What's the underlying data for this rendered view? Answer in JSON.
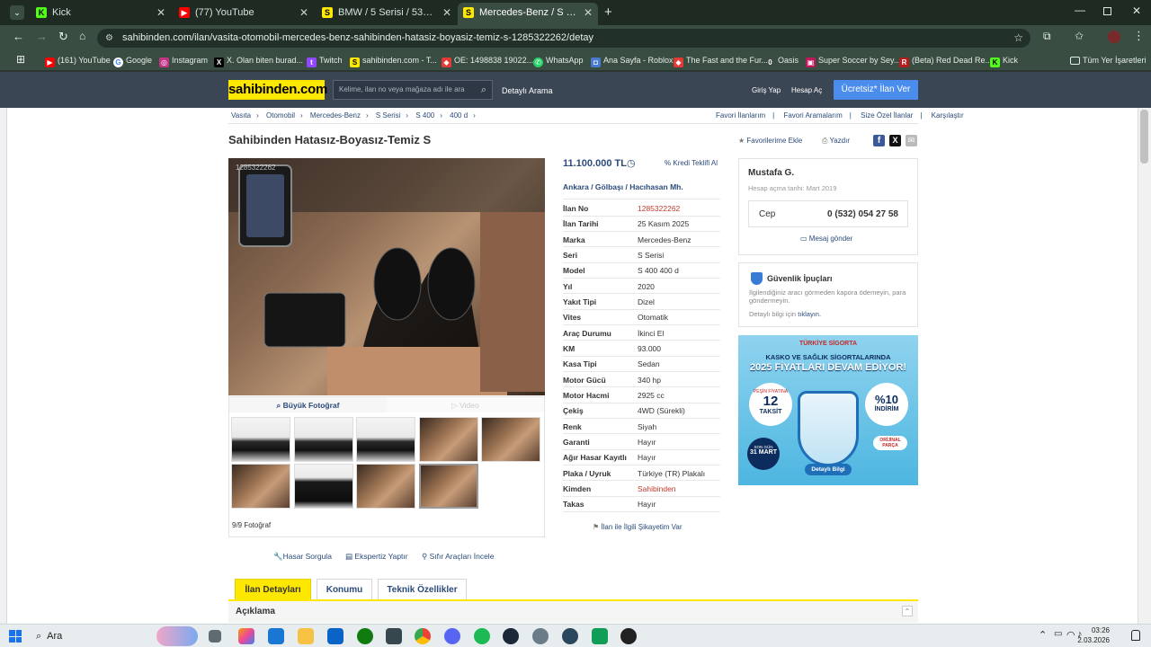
{
  "browser": {
    "tabs": [
      {
        "label": "Kick",
        "active": false
      },
      {
        "label": "(77) YouTube",
        "active": false
      },
      {
        "label": "BMW / 5 Serisi / 530i / Standart",
        "active": false
      },
      {
        "label": "Mercedes-Benz / S Serisi / S 40",
        "active": true
      }
    ],
    "url": "sahibinden.com/ilan/vasita-otomobil-mercedes-benz-sahibinden-hatasiz-boyasiz-temiz-s-1285322262/detay",
    "bookmarks": [
      "(161) YouTube",
      "Google",
      "Instagram",
      "X. Olan biten burad...",
      "Twitch",
      "sahibinden.com - T...",
      "OE: 1498838 19022...",
      "WhatsApp",
      "Ana Sayfa - Roblox",
      "The Fast and the Fur...",
      "Oasis",
      "Super Soccer by Sey...",
      "(Beta) Red Dead Re...",
      "Kick"
    ],
    "all_bookmarks": "Tüm Yer İşaretleri"
  },
  "site": {
    "logo": "sahibinden.com",
    "search_placeholder": "Kelime, ilan no veya mağaza adı ile ara",
    "detailed_search": "Detaylı Arama",
    "login": "Giriş Yap",
    "register": "Hesap Aç",
    "free_ad": "Ücretsiz* İlan Ver"
  },
  "breadcrumbs": [
    "Vasıta",
    "Otomobil",
    "Mercedes-Benz",
    "S Serisi",
    "S 400",
    "400 d"
  ],
  "top_links": [
    "Favori İlanlarım",
    "Favori Aramalarım",
    "Size Özel İlanlar",
    "Karşılaştır"
  ],
  "listing": {
    "title": "Sahibinden Hatasız-Boyasız-Temiz S",
    "add_favorite": "Favorilerime Ekle",
    "print": "Yazdır",
    "watermark": "1285322262",
    "big_photo": "Büyük Fotoğraf",
    "video": "Video",
    "photo_count": "9/9 Fotoğraf",
    "price": "11.100.000 TL",
    "credit": "Kredi Teklifi Al",
    "location": [
      "Ankara",
      "Gölbaşı",
      "Hacıhasan Mh."
    ],
    "specs": [
      {
        "label": "İlan No",
        "value": "1285322262",
        "highlight": true
      },
      {
        "label": "İlan Tarihi",
        "value": "25 Kasım 2025"
      },
      {
        "label": "Marka",
        "value": "Mercedes-Benz"
      },
      {
        "label": "Seri",
        "value": "S Serisi"
      },
      {
        "label": "Model",
        "value": "S 400 400 d"
      },
      {
        "label": "Yıl",
        "value": "2020"
      },
      {
        "label": "Yakıt Tipi",
        "value": "Dizel"
      },
      {
        "label": "Vites",
        "value": "Otomatik"
      },
      {
        "label": "Araç Durumu",
        "value": "İkinci El"
      },
      {
        "label": "KM",
        "value": "93.000"
      },
      {
        "label": "Kasa Tipi",
        "value": "Sedan"
      },
      {
        "label": "Motor Gücü",
        "value": "340 hp"
      },
      {
        "label": "Motor Hacmi",
        "value": "2925 cc"
      },
      {
        "label": "Çekiş",
        "value": "4WD (Sürekli)"
      },
      {
        "label": "Renk",
        "value": "Siyah"
      },
      {
        "label": "Garanti",
        "value": "Hayır"
      },
      {
        "label": "Ağır Hasar Kayıtlı",
        "value": "Hayır"
      },
      {
        "label": "Plaka / Uyruk",
        "value": "Türkiye (TR) Plakalı"
      },
      {
        "label": "Kimden",
        "value": "Sahibinden",
        "highlight": true
      },
      {
        "label": "Takas",
        "value": "Hayır"
      }
    ],
    "complaint": "İlan ile İlgili Şikayetim Var",
    "actions": [
      "Hasar Sorgula",
      "Ekspertiz Yaptır",
      "Sıfır Araçları İncele"
    ]
  },
  "seller": {
    "name": "Mustafa G.",
    "since": "Hesap açma tarihi: Mart 2019",
    "phone_label": "Cep",
    "phone": "0 (532) 054 27 58",
    "message": "Mesaj gönder"
  },
  "safety": {
    "title": "Güvenlik İpuçları",
    "text": "İlgilendiğiniz aracı görmeden kapora ödemeyin, para göndermeyin.",
    "more_prefix": "Detaylı bilgi için",
    "more_link": "tıklayın."
  },
  "ad": {
    "brand": "TÜRKİYE SİGORTA",
    "line1": "KASKO VE SAĞLIK SİGORTALARINDA",
    "line2": "2025 FİYATLARI DEVAM EDİYOR!",
    "badge_left_top": "PEŞİN FİYATINA",
    "badge_left_num": "12",
    "badge_left_bottom": "TAKSİT",
    "badge_right": "%10",
    "badge_right_bottom": "İNDİRİM",
    "date_badge_top": "SON GÜN",
    "date_badge": "31 MART",
    "parts": "ORİJİNAL PARÇA",
    "cta": "Detaylı Bilgi"
  },
  "bottom_tabs": [
    "İlan Detayları",
    "Konumu",
    "Teknik Özellikler"
  ],
  "description_header": "Açıklama",
  "taskbar": {
    "search": "Ara",
    "time": "03:26",
    "date": "2.03.2026"
  },
  "colors": {
    "brand_yellow": "#ffe800",
    "header": "#3b4654",
    "link": "#2b4b7a",
    "price": "#2b4b7a",
    "highlight": "#c0392b",
    "cta": "#4b8ded"
  }
}
